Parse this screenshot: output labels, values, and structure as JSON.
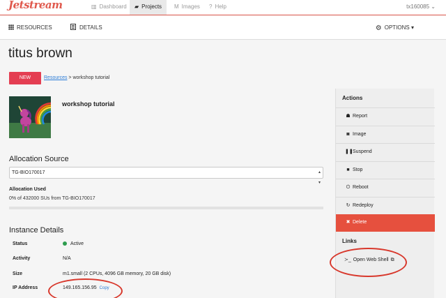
{
  "brand": {
    "logo": "Jetstream",
    "accent": "#e05a4e"
  },
  "nav": {
    "dashboard": "Dashboard",
    "projects": "Projects",
    "images": "Images",
    "help": "Help",
    "user": "tx160085 ⌄"
  },
  "subnav": {
    "resources": "RESOURCES",
    "details": "DETAILS",
    "options": "OPTIONS ▾"
  },
  "page": {
    "title": "titus brown",
    "new_button": "NEW",
    "breadcrumb_link": "Resources",
    "breadcrumb_rest": " > workshop tutorial"
  },
  "project": {
    "name": "workshop tutorial",
    "image_icon": "rainbow-unicorn-image"
  },
  "allocation": {
    "title": "Allocation Source",
    "selected": "TG-BIO170017",
    "used_label": "Allocation Used",
    "used_value": "0% of 432000 SUs from TG-BIO170017",
    "used_fraction": 0
  },
  "instance": {
    "title": "Instance Details",
    "status_label": "Status",
    "status_value": "Active",
    "status_color": "#2e9d4f",
    "activity_label": "Activity",
    "activity_value": "N/A",
    "size_label": "Size",
    "size_value": "m1.small (2 CPUs, 4096 GB memory, 20 GB disk)",
    "ip_label": "IP Address",
    "ip_value": "149.165.156.95",
    "copy": "Copy"
  },
  "actions": {
    "title": "Actions",
    "report": "Report",
    "image": "Image",
    "suspend": "Suspend",
    "stop": "Stop",
    "reboot": "Reboot",
    "redeploy": "Redeploy",
    "delete": "Delete",
    "delete_color": "#e6503e"
  },
  "links": {
    "title": "Links",
    "web_shell": "Open Web Shell"
  }
}
